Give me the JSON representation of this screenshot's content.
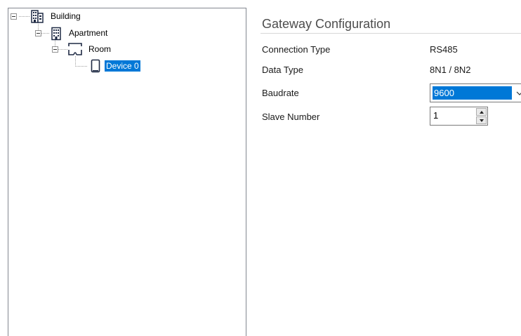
{
  "tree": {
    "nodes": [
      {
        "label": "Building",
        "icon": "building-icon"
      },
      {
        "label": "Apartment",
        "icon": "apartment-icon"
      },
      {
        "label": "Room",
        "icon": "room-icon"
      },
      {
        "label": "Device 0",
        "icon": "device-icon",
        "selected": true
      }
    ]
  },
  "config": {
    "title": "Gateway Configuration",
    "rows": [
      {
        "label": "Connection Type",
        "value": "RS485"
      },
      {
        "label": "Data Type",
        "value": "8N1 / 8N2"
      },
      {
        "label": "Baudrate",
        "value": "9600",
        "control": "dropdown"
      },
      {
        "label": "Slave Number",
        "value": "1",
        "control": "spinner"
      }
    ]
  },
  "colors": {
    "selection": "#0078d7",
    "border": "#828790",
    "title": "#4d4d4d"
  }
}
